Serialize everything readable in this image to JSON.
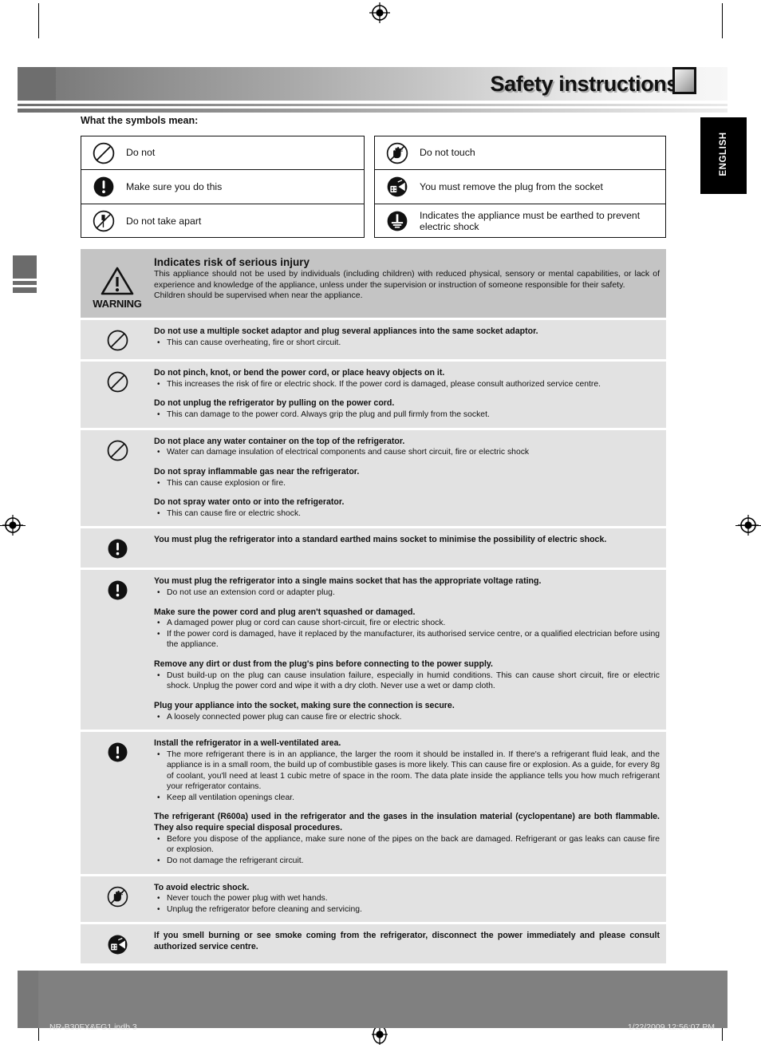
{
  "header": {
    "title": "Safety instructions",
    "square_icon": "square-icon"
  },
  "language_tab": {
    "label": "ENGLISH"
  },
  "symbols": {
    "heading": "What the symbols mean:",
    "left_column": [
      {
        "icon": "do-not-icon",
        "label": "Do not"
      },
      {
        "icon": "mandatory-action-icon",
        "label": "Make sure you do this"
      },
      {
        "icon": "do-not-disassemble-icon",
        "label": "Do not take apart"
      }
    ],
    "right_column": [
      {
        "icon": "do-not-touch-icon",
        "label": "Do not touch"
      },
      {
        "icon": "unplug-icon",
        "label": "You must remove the plug from the socket"
      },
      {
        "icon": "earth-ground-icon",
        "label": "Indicates the appliance must be earthed to prevent electric shock"
      }
    ]
  },
  "warning": {
    "word": "WARNING",
    "icon": "warning-triangle-icon",
    "title": "Indicates risk of serious injury",
    "paragraph_1": "This appliance should not be used by individuals (including children) with reduced physical, sensory or mental capabilities, or lack of experience and knowledge of the appliance, unless under the supervision or instruction of someone responsible for their safety.",
    "paragraph_2": "Children should be supervised when near the appliance."
  },
  "risk_rows": [
    {
      "icon": "do-not-icon",
      "blocks": [
        {
          "title": "Do not use a multiple socket adaptor and plug several appliances into the same socket adaptor.",
          "bullets": [
            "This can cause overheating, fire or short circuit."
          ]
        }
      ]
    },
    {
      "icon": "do-not-icon",
      "blocks": [
        {
          "title": "Do not pinch, knot, or bend the power cord, or place heavy objects on it.",
          "bullets": [
            "This increases the risk of fire or electric shock. If the power cord is damaged, please consult authorized service centre."
          ]
        },
        {
          "title": "Do not unplug the refrigerator by pulling on the power cord.",
          "bullets": [
            "This can damage to the power cord. Always grip the plug and pull firmly from the socket."
          ]
        }
      ]
    },
    {
      "icon": "do-not-icon",
      "blocks": [
        {
          "title": "Do not place any water container on the top of the refrigerator.",
          "bullets": [
            "Water can damage insulation of electrical components and cause short circuit, fire or electric shock"
          ]
        },
        {
          "title": "Do not spray inflammable gas near the refrigerator.",
          "bullets": [
            "This can cause explosion or fire."
          ]
        },
        {
          "title": "Do not spray water onto or into the refrigerator.",
          "bullets": [
            "This can cause fire or electric shock."
          ]
        }
      ]
    },
    {
      "icon": "mandatory-action-icon",
      "blocks": [
        {
          "title": "You must plug the refrigerator into a standard earthed mains socket to minimise the possibility of electric shock.",
          "bullets": []
        }
      ]
    },
    {
      "icon": "mandatory-action-icon",
      "blocks": [
        {
          "title": "You must plug the refrigerator into a single mains socket that has the appropriate voltage rating.",
          "bullets": [
            "Do not use an extension cord or adapter plug."
          ]
        },
        {
          "title": "Make sure the power cord and plug aren't squashed or damaged.",
          "bullets": [
            "A damaged power plug or cord can cause short-circuit, fire or electric shock.",
            "If the power cord is damaged, have it replaced by the manufacturer, its authorised service centre, or a qualified electrician before using the appliance."
          ]
        },
        {
          "title": "Remove any dirt or dust from the plug's pins before connecting to the power supply.",
          "bullets": [
            "Dust build-up on the plug can cause insulation failure, especially in humid conditions. This can cause short circuit, fire or electric shock. Unplug the power cord and wipe it with a dry cloth. Never use a wet or damp cloth."
          ]
        },
        {
          "title": "Plug your appliance into the socket, making sure the connection is secure.",
          "bullets": [
            "A loosely connected power plug can cause fire or electric shock."
          ]
        }
      ]
    },
    {
      "icon": "mandatory-action-icon",
      "blocks": [
        {
          "title": "Install the refrigerator in a well-ventilated area.",
          "bullets": [
            "The more refrigerant there is in an appliance, the larger the room it should be installed in. If there's a refrigerant fluid leak, and the appliance is in a small room, the build up of combustible gases is more likely. This can cause fire or explosion. As a guide, for every 8g of coolant, you'll need at least 1 cubic metre of space in the room. The data plate inside the appliance tells you how much refrigerant your refrigerator contains.",
            "Keep all ventilation openings clear."
          ]
        },
        {
          "title": "The refrigerant (R600a) used in the refrigerator and the gases in the insulation material (cyclopentane) are both flammable. They also require special disposal procedures.",
          "bullets": [
            "Before you dispose of the appliance, make sure none of the pipes on the back are damaged. Refrigerant or gas leaks can cause fire or explosion.",
            "Do not damage the refrigerant circuit."
          ]
        }
      ]
    },
    {
      "icon": "do-not-touch-icon",
      "blocks": [
        {
          "title": "To avoid electric shock.",
          "bullets": [
            "Never touch the power plug with wet hands.",
            "Unplug the refrigerator before cleaning and servicing."
          ]
        }
      ]
    },
    {
      "icon": "unplug-icon",
      "blocks": [
        {
          "title": "If you smell burning or see smoke coming from the refrigerator, disconnect the power immediately and please consult authorized service centre.",
          "bullets": []
        }
      ]
    }
  ],
  "footer": {
    "page_number": "3",
    "file_name": "NR-B30FX&FG1.indb   3",
    "timestamp": "1/22/2009   12:56:07 PM"
  }
}
